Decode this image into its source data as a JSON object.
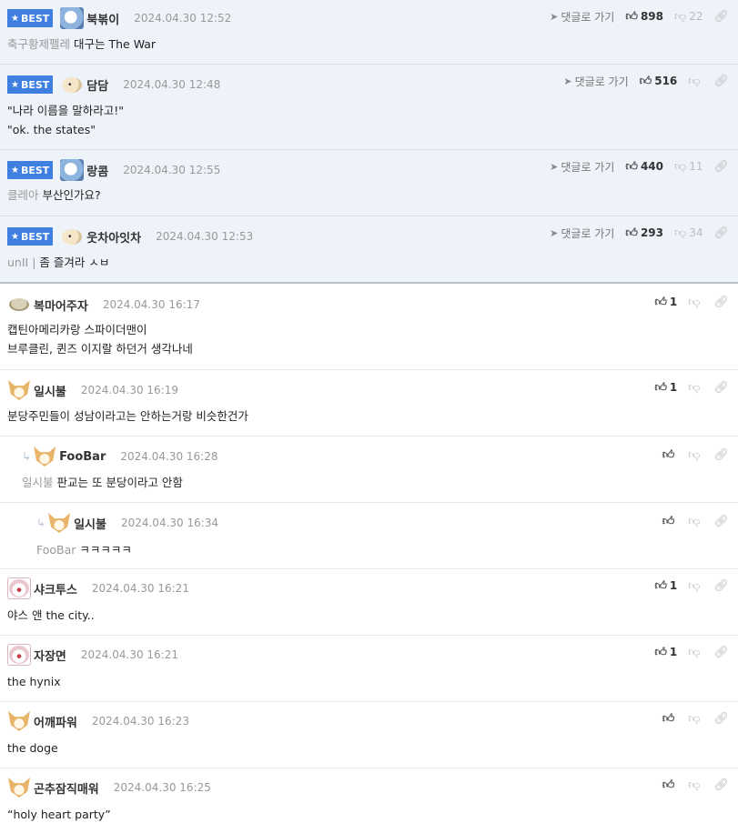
{
  "labels": {
    "best": "BEST",
    "goto": "댓글로 가기"
  },
  "comments": [
    {
      "nick": "북볶이",
      "date": "2024.04.30 12:52",
      "likes": "898",
      "dislikes": "22",
      "mention": "축구황제펠레",
      "text": "대구는 The War"
    },
    {
      "nick": "담담",
      "date": "2024.04.30 12:48",
      "likes": "516",
      "dislikes": "",
      "mention": "",
      "line1": "\"나라 이름을 말하라고!\"",
      "line2": "\"ok. the states\""
    },
    {
      "nick": "랑콤",
      "date": "2024.04.30 12:55",
      "likes": "440",
      "dislikes": "11",
      "mention": "클레아",
      "text": "부산인가요?"
    },
    {
      "nick": "웃차아잇차",
      "date": "2024.04.30 12:53",
      "likes": "293",
      "dislikes": "34",
      "mention": "unII |",
      "text": "좀 즐겨라 ㅅㅂ"
    },
    {
      "nick": "복마어주자",
      "date": "2024.04.30 16:17",
      "likes": "1",
      "line1": "캡틴아메리카랑 스파이더맨이",
      "line2": "브루클린, 퀸즈 이지랄 하던거 생각나네"
    },
    {
      "nick": "일시불",
      "date": "2024.04.30 16:19",
      "likes": "1",
      "text": "분당주민들이 성남이라고는 안하는거랑 비슷한건가"
    },
    {
      "nick": "FooBar",
      "date": "2024.04.30 16:28",
      "likes": "",
      "mention": "일시불",
      "text": "판교는 또 분당이라고 안함"
    },
    {
      "nick": "일시불",
      "date": "2024.04.30 16:34",
      "likes": "",
      "mention": "FooBar",
      "text": "ㅋㅋㅋㅋㅋ"
    },
    {
      "nick": "샤크투스",
      "date": "2024.04.30 16:21",
      "likes": "1",
      "text": "야스 앤 the city.."
    },
    {
      "nick": "자장면",
      "date": "2024.04.30 16:21",
      "likes": "1",
      "text": "the hynix"
    },
    {
      "nick": "어깨파워",
      "date": "2024.04.30 16:23",
      "likes": "",
      "text": "the doge"
    },
    {
      "nick": "곤추잠직매워",
      "date": "2024.04.30 16:25",
      "likes": "",
      "text": "“holy heart party”"
    }
  ]
}
